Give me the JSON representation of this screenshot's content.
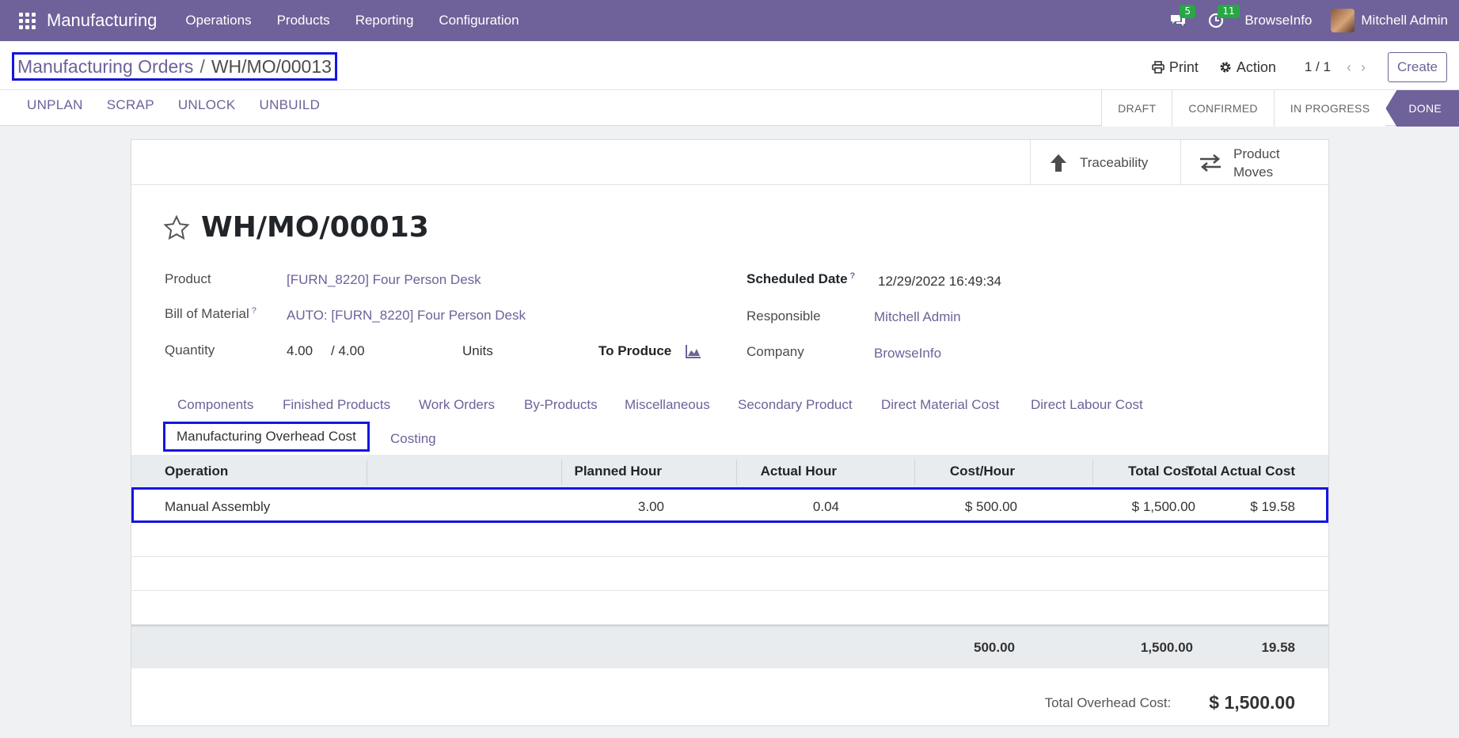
{
  "navbar": {
    "app_name": "Manufacturing",
    "menu": [
      "Operations",
      "Products",
      "Reporting",
      "Configuration"
    ],
    "messages_count": "5",
    "activities_count": "11",
    "company": "BrowseInfo",
    "user": "Mitchell Admin",
    "accent_color": "#6f6199"
  },
  "control_panel": {
    "breadcrumb_parent": "Manufacturing Orders",
    "breadcrumb_sep": "/",
    "breadcrumb_current": "WH/MO/00013",
    "print_label": "Print",
    "action_label": "Action",
    "pager": "1 / 1",
    "create_label": "Create",
    "actions": [
      "UNPLAN",
      "SCRAP",
      "UNLOCK",
      "UNBUILD"
    ],
    "stages": [
      "DRAFT",
      "CONFIRMED",
      "IN PROGRESS",
      "DONE"
    ],
    "current_stage": "DONE"
  },
  "smart_buttons": {
    "traceability": "Traceability",
    "product_moves_1": "Product",
    "product_moves_2": "Moves"
  },
  "form": {
    "title": "WH/MO/00013",
    "product_label": "Product",
    "product_value": "[FURN_8220] Four Person Desk",
    "bom_label": "Bill of Material",
    "bom_value": "AUTO: [FURN_8220] Four Person Desk",
    "quantity_label": "Quantity",
    "quantity_value": "4.00",
    "quantity_total": "/ 4.00",
    "uom": "Units",
    "to_produce_label": "To Produce",
    "scheduled_date_label": "Scheduled Date",
    "scheduled_date_value": "12/29/2022 16:49:34",
    "responsible_label": "Responsible",
    "responsible_value": "Mitchell Admin",
    "company_label": "Company",
    "company_value": "BrowseInfo",
    "help_mark": "?"
  },
  "tabs": [
    "Components",
    "Finished Products",
    "Work Orders",
    "By-Products",
    "Miscellaneous",
    "Secondary Product",
    "Direct Material Cost",
    "Direct Labour Cost",
    "Manufacturing Overhead Cost",
    "Costing"
  ],
  "active_tab": "Manufacturing Overhead Cost",
  "grid": {
    "columns": [
      "Operation",
      "Planned Hour",
      "Actual Hour",
      "Cost/Hour",
      "Total Cost",
      "Total Actual Cost"
    ],
    "rows": [
      [
        "Manual Assembly",
        "3.00",
        "0.04",
        "$ 500.00",
        "$ 1,500.00",
        "$ 19.58"
      ]
    ],
    "footer": [
      "500.00",
      "1,500.00",
      "19.58"
    ],
    "total_label": "Total Overhead Cost:",
    "total_value": "$ 1,500.00"
  }
}
